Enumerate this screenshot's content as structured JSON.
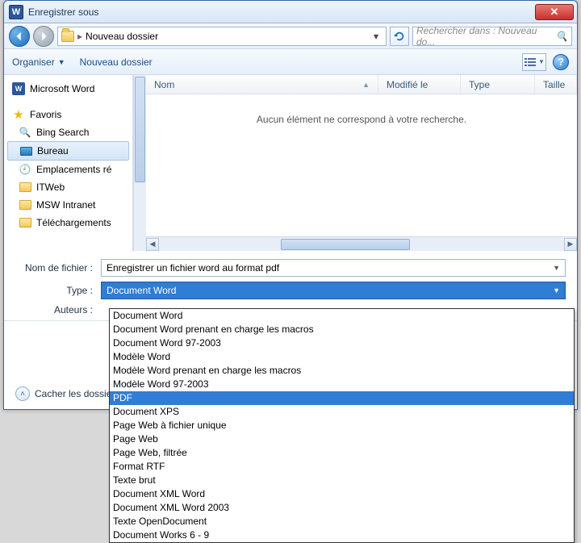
{
  "window": {
    "title": "Enregistrer sous"
  },
  "nav": {
    "breadcrumb_sep": "▸",
    "location": "Nouveau dossier",
    "search_placeholder": "Rechercher dans : Nouveau do..."
  },
  "toolbar": {
    "organize": "Organiser",
    "new_folder": "Nouveau dossier"
  },
  "columns": {
    "name": "Nom",
    "modified": "Modifié le",
    "type": "Type",
    "size": "Taille"
  },
  "empty_message": "Aucun élément ne correspond à votre recherche.",
  "tree": {
    "ms_word": "Microsoft Word",
    "favorites": "Favoris",
    "items": [
      "Bing Search",
      "Bureau",
      "Emplacements ré",
      "ITWeb",
      "MSW Intranet",
      "Téléchargements"
    ]
  },
  "form": {
    "filename_label": "Nom de fichier :",
    "filename_value": "Enregistrer un fichier word au format pdf",
    "type_label": "Type :",
    "type_value": "Document Word",
    "authors_label": "Auteurs :",
    "hide_folders": "Cacher les dossier"
  },
  "type_options": [
    "Document Word",
    "Document Word prenant en charge les macros",
    "Document Word 97-2003",
    "Modèle Word",
    "Modèle Word prenant en charge les macros",
    "Modèle Word 97-2003",
    "PDF",
    "Document XPS",
    "Page Web à fichier unique",
    "Page Web",
    "Page Web, filtrée",
    "Format RTF",
    "Texte brut",
    "Document XML Word",
    "Document XML Word 2003",
    "Texte OpenDocument",
    "Document Works 6 - 9"
  ],
  "type_highlight_index": 6
}
